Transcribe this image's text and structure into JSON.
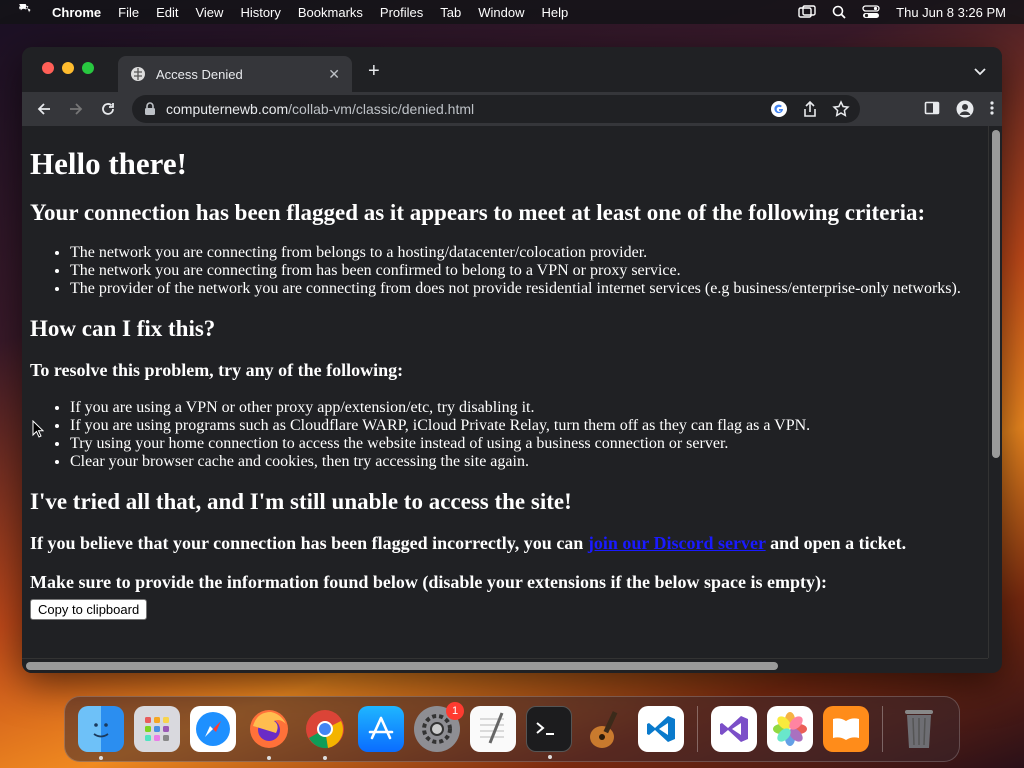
{
  "menubar": {
    "app": "Chrome",
    "items": [
      "File",
      "Edit",
      "View",
      "History",
      "Bookmarks",
      "Profiles",
      "Tab",
      "Window",
      "Help"
    ],
    "clock": "Thu Jun 8  3:26 PM"
  },
  "browser": {
    "tab_title": "Access Denied",
    "url_host": "computernewb.com",
    "url_path": "/collab-vm/classic/denied.html"
  },
  "page": {
    "h1": "Hello there!",
    "h2_criteria": "Your connection has been flagged as it appears to meet at least one of the following criteria:",
    "criteria": [
      "The network you are connecting from belongs to a hosting/datacenter/colocation provider.",
      "The network you are connecting from has been confirmed to belong to a VPN or proxy service.",
      "The provider of the network you are connecting from does not provide residential internet services (e.g business/enterprise-only networks)."
    ],
    "h2_fix": "How can I fix this?",
    "h3_resolve": "To resolve this problem, try any of the following:",
    "fixes": [
      "If you are using a VPN or other proxy app/extension/etc, try disabling it.",
      "If you are using programs such as Cloudflare WARP, iCloud Private Relay, turn them off as they can flag as a VPN.",
      "Try using your home connection to access the website instead of using a business connection or server.",
      "Clear your browser cache and cookies, then try accessing the site again."
    ],
    "h2_tried": "I've tried all that, and I'm still unable to access the site!",
    "discord_pre": "If you believe that your connection has been flagged incorrectly, you can ",
    "discord_link": "join our Discord server",
    "discord_post": " and open a ticket.",
    "info_text": "Make sure to provide the information found below (disable your extensions if the below space is empty):",
    "copy_button": "Copy to clipboard"
  },
  "dock": {
    "apps": [
      "finder-icon",
      "launchpad-icon",
      "safari-icon",
      "firefox-icon",
      "chrome-icon",
      "app-store-icon",
      "system-settings-icon",
      "textedit-icon",
      "terminal-icon",
      "garageband-icon",
      "vscode-icon",
      "visual-studio-icon",
      "photos-icon",
      "books-icon",
      "trash-icon"
    ],
    "settings_badge": "1"
  }
}
